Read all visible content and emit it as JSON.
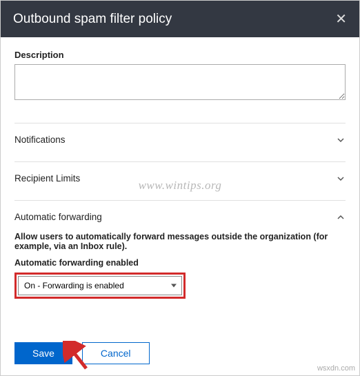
{
  "header": {
    "title": "Outbound spam filter policy"
  },
  "description": {
    "label": "Description",
    "value": ""
  },
  "sections": {
    "notifications": {
      "title": "Notifications"
    },
    "recipientLimits": {
      "title": "Recipient Limits"
    },
    "automaticForwarding": {
      "title": "Automatic forwarding",
      "helpText": "Allow users to automatically forward messages outside the organization (for example, via an Inbox rule).",
      "dropdownLabel": "Automatic forwarding enabled",
      "selectedOption": "On - Forwarding is enabled"
    }
  },
  "footer": {
    "save": "Save",
    "cancel": "Cancel"
  },
  "watermark": "www.wintips.org",
  "credit": "wsxdn.com"
}
